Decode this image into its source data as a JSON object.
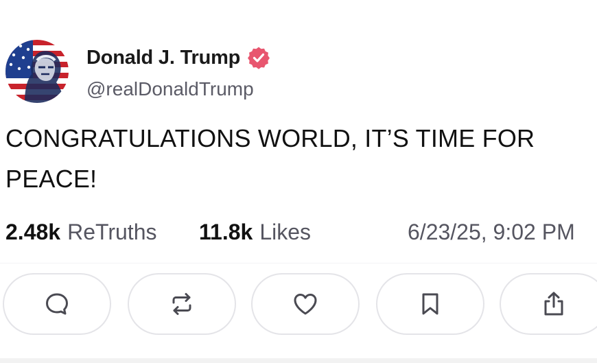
{
  "author": {
    "display_name": "Donald J. Trump",
    "handle": "@realDonaldTrump",
    "verified": true,
    "avatar_icon": "american-flag-portrait-avatar"
  },
  "post": {
    "text": "CONGRATULATIONS WORLD, IT’S TIME FOR PEACE!"
  },
  "stats": {
    "retruths_count": "2.48k",
    "retruths_label": "ReTruths",
    "likes_count": "11.8k",
    "likes_label": "Likes",
    "timestamp": "6/23/25, 9:02 PM"
  },
  "actions": [
    {
      "name": "reply",
      "icon": "speech-bubble-icon"
    },
    {
      "name": "retruth",
      "icon": "repost-arrows-icon"
    },
    {
      "name": "like",
      "icon": "heart-icon"
    },
    {
      "name": "bookmark",
      "icon": "bookmark-icon"
    },
    {
      "name": "share",
      "icon": "share-upload-icon"
    }
  ],
  "colors": {
    "verified_badge": "#e8566f",
    "icon_stroke": "#4a4a52",
    "secondary_text": "#555560",
    "button_border": "#e4e4e8"
  }
}
